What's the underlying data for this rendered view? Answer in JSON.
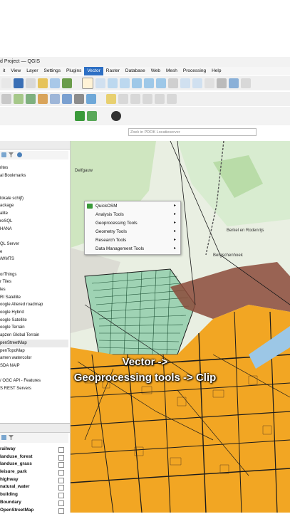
{
  "window": {
    "title": "d Project — QGIS"
  },
  "menubar": {
    "items": [
      "it",
      "View",
      "Layer",
      "Settings",
      "Plugins",
      "Vector",
      "Raster",
      "Database",
      "Web",
      "Mesh",
      "Processing",
      "Help"
    ],
    "active_index": 5
  },
  "locator": {
    "placeholder": "Zoek in PDOK Locatieserver"
  },
  "browser": {
    "items": [
      "rites",
      "al Bookmarks",
      "",
      "",
      "lokale schijf)",
      "ackage",
      "alite",
      "reSQL",
      "HANA",
      "",
      "QL Server",
      "e",
      "/WMTS",
      "",
      "orThings",
      "r Tiles",
      "les",
      "RI Satellite",
      "oogle Altered roadmap",
      "oogle Hybrid",
      "oogle Satellite",
      "oogle Terrain",
      "apzen Global Terrain",
      "penStreetMap",
      "penTopoMap",
      "amen watercolor",
      "SDA NAIP",
      "",
      "/ OGC API - Features",
      "S REST Servers"
    ]
  },
  "layers": {
    "items": [
      "railway",
      "landuse_forest",
      "landuse_grass",
      "leisure_park",
      "highway",
      "natural_water",
      "building",
      "Boundary",
      "OpenStreetMap"
    ]
  },
  "vector_menu": {
    "items": [
      "QuickOSM",
      "Analysis Tools",
      "Geoprocessing Tools",
      "Geometry Tools",
      "Research Tools",
      "Data Management Tools"
    ],
    "has_submenu": [
      true,
      true,
      true,
      true,
      true,
      true
    ]
  },
  "map": {
    "labels": [
      "Delfgauw",
      "Berkel en Rodenrijs",
      "Bergschenhoek"
    ]
  },
  "caption": {
    "line1": "Vector ->",
    "line2": "Geoprocessing tools -> Clip"
  },
  "colors": {
    "accent": "#2d6fc4",
    "building": "#f5a81f",
    "boundary": "#8b4a3a",
    "road": "#1a1a1a"
  }
}
